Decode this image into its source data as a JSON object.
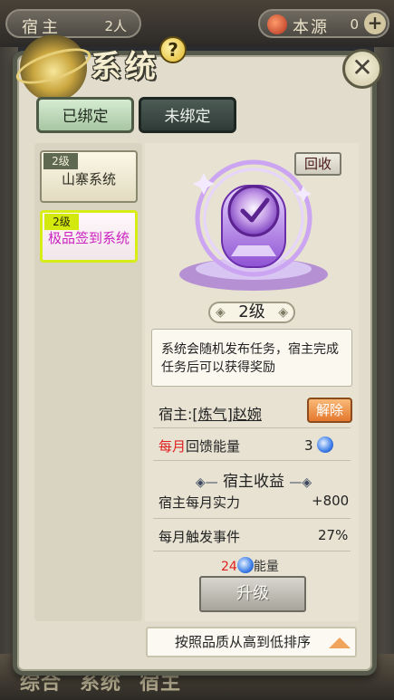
{
  "hud": {
    "host_label": "宿主",
    "host_value": "2人",
    "source_label": "本源",
    "source_value": "0",
    "add_label": "+"
  },
  "bottom_tabs": [
    "综合",
    "系统",
    "宿主"
  ],
  "window": {
    "title": "系统",
    "help_label": "?",
    "close_label": "✕"
  },
  "tabs": {
    "bound": "已绑定",
    "unbound": "未绑定"
  },
  "systems": [
    {
      "level": "2级",
      "name": "山寨系统"
    },
    {
      "level": "2级",
      "name": "极品签到系统"
    }
  ],
  "detail": {
    "recycle_label": "回收",
    "level": "2级",
    "description": "系统会随机发布任务，宿主完成任务后可以获得奖励",
    "host_prefix": "宿主:",
    "host_name": "[炼气]赵婉",
    "unbind_label": "解除",
    "monthly_prefix": "每月",
    "monthly_label": "回馈能量",
    "monthly_value": "3",
    "income_title": "宿主收益",
    "stats": [
      {
        "label": "宿主每月实力",
        "value": "+800"
      },
      {
        "label": "每月触发事件",
        "value": "27%"
      }
    ],
    "cost_value": "24",
    "cost_label": "能量",
    "upgrade_label": "升级"
  },
  "sort": {
    "label": "按照品质从高到低排序"
  },
  "colors": {
    "selected_border": "#d8ec16",
    "selected_text": "#cc22c0",
    "highlight_red": "#e02020",
    "unbind_orange": "#e4782e"
  }
}
